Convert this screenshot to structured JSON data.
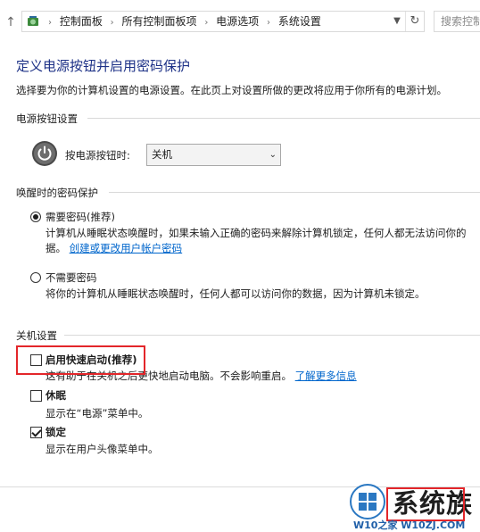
{
  "address_bar": {
    "breadcrumbs": [
      "控制面板",
      "所有控制面板项",
      "电源选项",
      "系统设置"
    ],
    "search_placeholder": "搜索控制"
  },
  "page": {
    "title": "定义电源按钮并启用密码保护",
    "description": "选择要为你的计算机设置的电源设置。在此页上对设置所做的更改将应用于你所有的电源计划。"
  },
  "power_button_section": {
    "heading": "电源按钮设置",
    "label": "按电源按钮时:",
    "selected": "关机"
  },
  "wakeup_password_section": {
    "heading": "唤醒时的密码保护",
    "options": [
      {
        "label": "需要密码(推荐)",
        "checked": true,
        "desc_line1": "计算机从睡眠状态唤醒时，如果未输入正确的密码来解除计算机锁定，任何人都无法访问你的",
        "desc_line2_prefix": "据。",
        "desc_link": "创建或更改用户帐户密码"
      },
      {
        "label": "不需要密码",
        "checked": false,
        "desc_line1": "将你的计算机从睡眠状态唤醒时，任何人都可以访问你的数据，因为计算机未锁定。"
      }
    ]
  },
  "shutdown_section": {
    "heading": "关机设置",
    "items": [
      {
        "label": "启用快速启动(推荐)",
        "checked": false,
        "desc": "这有助于在关机之后更快地启动电脑。不会影响重启。",
        "link": "了解更多信息"
      },
      {
        "label": "休眠",
        "checked": false,
        "desc": "显示在“电源”菜单中。"
      },
      {
        "label": "锁定",
        "checked": true,
        "desc": "显示在用户头像菜单中。"
      }
    ]
  },
  "watermark": {
    "text": "系统族",
    "url": "W10之家 W10ZJ.COM"
  },
  "colors": {
    "title_blue": "#1e3287",
    "link_blue": "#0066cc",
    "highlight_red": "#e3262a"
  }
}
